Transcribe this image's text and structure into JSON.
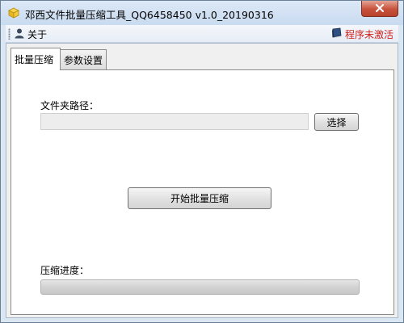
{
  "window": {
    "title": "邓西文件批量压缩工具_QQ6458450 v1.0_20190316"
  },
  "menubar": {
    "about_label": "关于",
    "activate_label": "程序未激活"
  },
  "tabs": [
    {
      "label": "批量压缩",
      "active": true
    },
    {
      "label": "参数设置",
      "active": false
    }
  ],
  "main": {
    "folder_label": "文件夹路径：",
    "folder_value": "",
    "select_button": "选择",
    "start_button": "开始批量压缩",
    "progress_label": "压缩进度：",
    "progress_percent": 0
  },
  "colors": {
    "activate_text": "#d0201a",
    "close_button": "#c7513b"
  }
}
